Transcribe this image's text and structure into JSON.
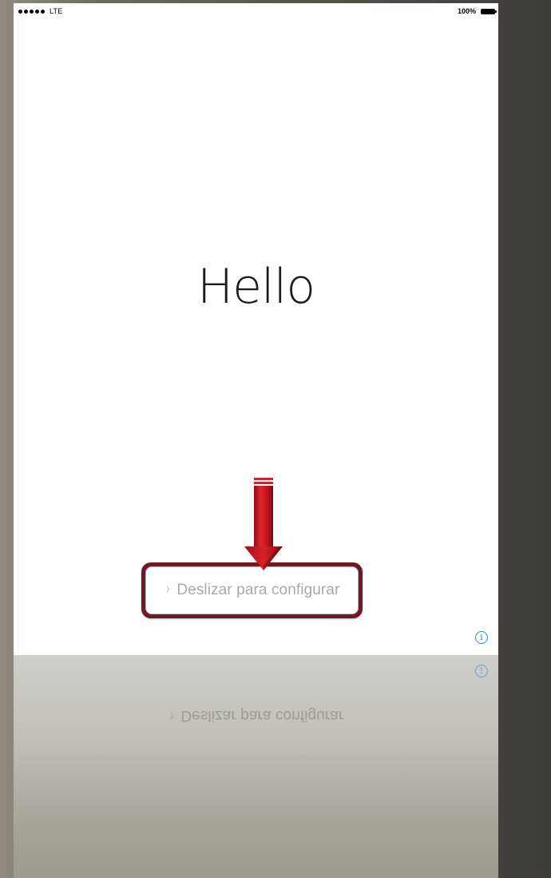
{
  "status_bar": {
    "carrier": "LTE",
    "battery_percent": "100%"
  },
  "main": {
    "greeting": "Hello",
    "slide_label": "Deslizar para configurar",
    "chevron": "›",
    "info_glyph": "i"
  },
  "reflection": {
    "slide_label": "Deslizar para configurar",
    "info_glyph": "!"
  },
  "colors": {
    "highlight_frame": "#6e1a22",
    "arrow": "#c0161e",
    "info_blue": "#2e86e8"
  },
  "icons": {
    "signal": "signal-dots-icon",
    "battery": "battery-icon",
    "info": "info-icon",
    "arrow": "down-arrow-icon",
    "chevron": "chevron-right-icon"
  }
}
